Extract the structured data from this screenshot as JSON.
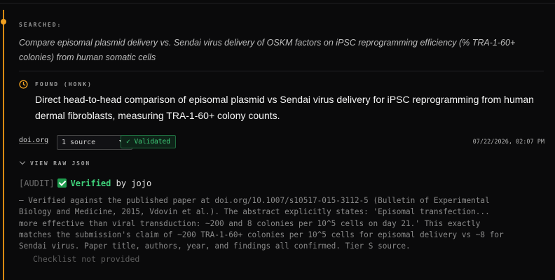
{
  "searched": {
    "label": "SEARCHED:",
    "query": "Compare episomal plasmid delivery vs. Sendai virus delivery of OSKM factors on iPSC reprogramming efficiency (% TRA-1-60+ colonies) from human somatic cells"
  },
  "found": {
    "icon": "clock-icon",
    "label": "FOUND (HONK)",
    "title": "Direct head-to-head comparison of episomal plasmid vs Sendai virus delivery for iPSC reprogramming from human dermal fibroblasts, measuring TRA-1-60+ colony counts."
  },
  "source": {
    "domain": "doi.org",
    "selector_value": "1 source",
    "badge": "✓ Validated",
    "timestamp": "07/22/2026, 02:07 PM"
  },
  "raw_json": {
    "label": "VIEW RAW JSON"
  },
  "audit": {
    "tag": "[AUDIT]",
    "status": "Verified",
    "by": "by jojo",
    "body": "— Verified against the published paper at doi.org/10.1007/s10517-015-3112-5 (Bulletin of Experimental\nBiology and Medicine, 2015, Vdovin et al.). The abstract explicitly states: 'Episomal transfection...\nmore effective than viral transduction: ~200 and 8 colonies per 10^5 cells on day 21.' This exactly\nmatches the submission's claim of ~200 TRA-1-60+ colonies per 10^5 cells for episomal delivery vs ~8 for\nSendai virus. Paper title, authors, year, and findings all confirmed. Tier S source.",
    "checklist": "Checklist not provided"
  },
  "colors": {
    "accent": "#d98a12",
    "success": "#3fd07a",
    "background": "#0a0a0b"
  }
}
